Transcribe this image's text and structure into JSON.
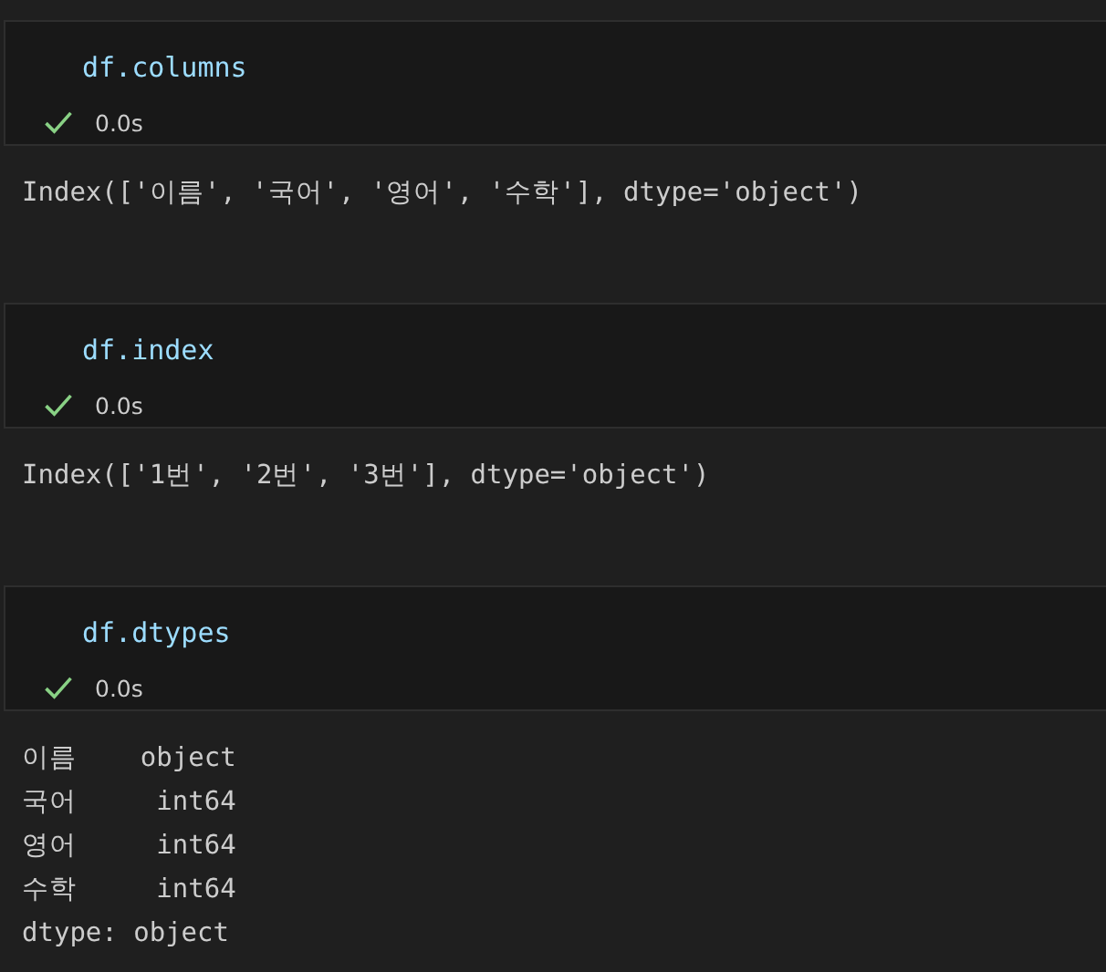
{
  "cells": [
    {
      "code": "df.columns",
      "status": {
        "succeeded": true,
        "time": "0.0s"
      },
      "output": [
        "Index(['이름', '국어', '영어', '수학'], dtype='object')"
      ]
    },
    {
      "code": "df.index",
      "status": {
        "succeeded": true,
        "time": "0.0s"
      },
      "output": [
        "Index(['1번', '2번', '3번'], dtype='object')"
      ]
    },
    {
      "code": "df.dtypes",
      "status": {
        "succeeded": true,
        "time": "0.0s"
      },
      "output": [
        "이름    object",
        "국어     int64",
        "영어     int64",
        "수학     int64",
        "dtype: object"
      ]
    }
  ]
}
